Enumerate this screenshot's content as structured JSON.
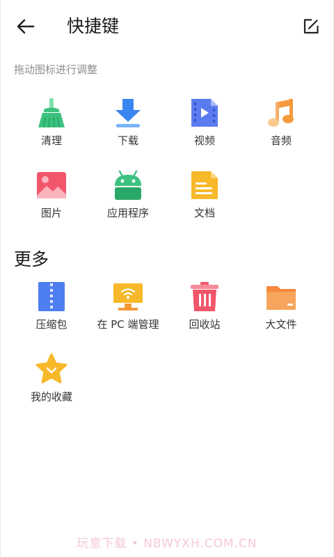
{
  "header": {
    "title": "快捷键",
    "back_icon": "arrow-left-icon",
    "edit_icon": "edit-icon"
  },
  "hint": "拖动图标进行调整",
  "shortcuts": [
    {
      "label": "清理",
      "icon": "broom-icon",
      "color": "#3cc27f"
    },
    {
      "label": "下载",
      "icon": "download-icon",
      "color": "#3a86f0"
    },
    {
      "label": "视频",
      "icon": "video-file-icon",
      "color": "#5b7cf0"
    },
    {
      "label": "音频",
      "icon": "music-note-icon",
      "color": "#f59a3c"
    },
    {
      "label": "图片",
      "icon": "image-icon",
      "color": "#f2566b"
    },
    {
      "label": "应用程序",
      "icon": "android-icon",
      "color": "#3cc27f"
    },
    {
      "label": "文档",
      "icon": "document-icon",
      "color": "#f7b82a"
    }
  ],
  "more": {
    "title": "更多",
    "items": [
      {
        "label": "压缩包",
        "icon": "zip-archive-icon",
        "color": "#4f7ef0"
      },
      {
        "label": "在 PC 端管理",
        "icon": "pc-wifi-icon",
        "color": "#f7b82a"
      },
      {
        "label": "回收站",
        "icon": "trash-icon",
        "color": "#f2566b"
      },
      {
        "label": "大文件",
        "icon": "folder-icon",
        "color": "#f5893a"
      },
      {
        "label": "我的收藏",
        "icon": "star-icon",
        "color": "#f7b82a"
      }
    ]
  },
  "watermark": "玩意下载 • NBWYXH.COM.CN"
}
